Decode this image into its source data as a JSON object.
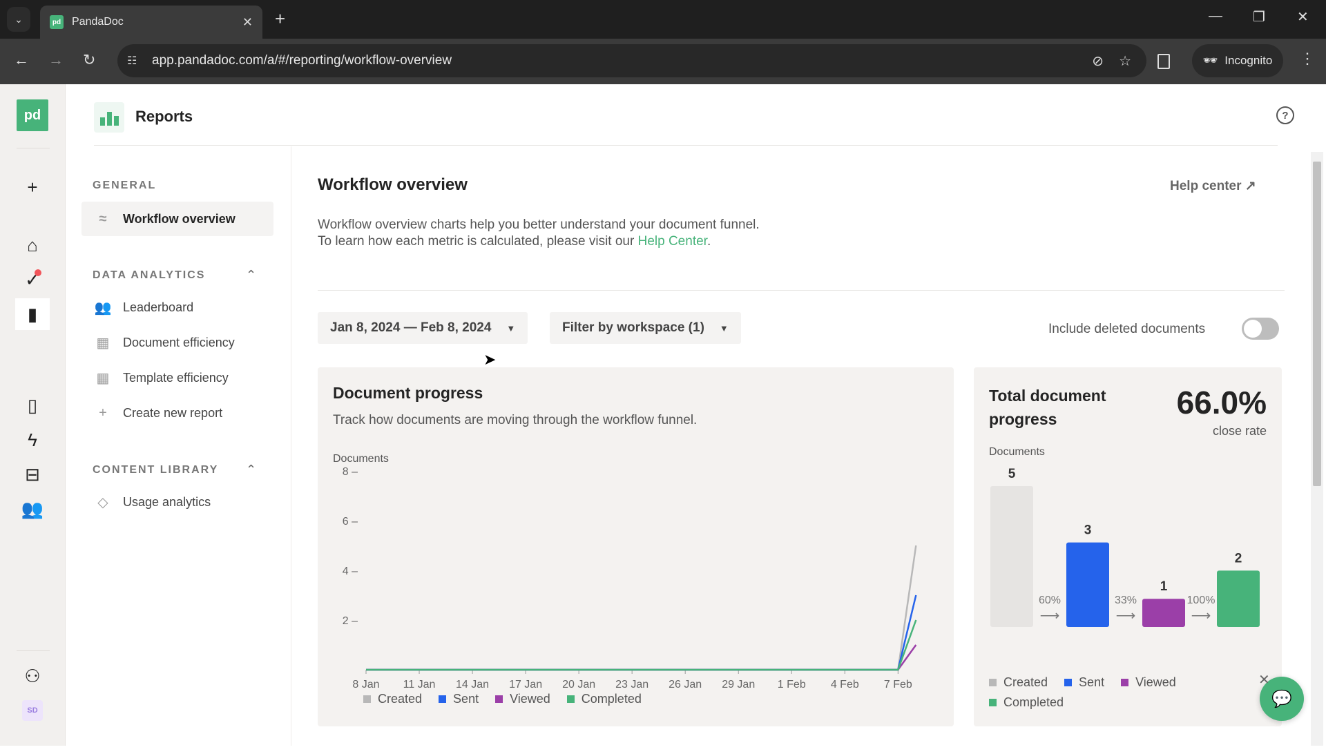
{
  "browser": {
    "tab_title": "PandaDoc",
    "tab_favicon": "pd",
    "url": "app.pandadoc.com/a/#/reporting/workflow-overview",
    "profile_label": "Incognito"
  },
  "rail": {
    "logo": "pd",
    "avatar_initials": "SD"
  },
  "header": {
    "title": "Reports"
  },
  "subnav": {
    "general_label": "GENERAL",
    "workflow_overview": "Workflow overview",
    "data_analytics_label": "DATA ANALYTICS",
    "data_items": [
      "Leaderboard",
      "Document efficiency",
      "Template efficiency",
      "Create new report"
    ],
    "content_library_label": "CONTENT LIBRARY",
    "content_items": [
      "Usage analytics"
    ]
  },
  "main": {
    "title": "Workflow overview",
    "help_center": "Help center",
    "description": "Workflow overview charts help you better understand your document funnel. To learn how each metric is calculated, please visit our ",
    "description_link": "Help Center",
    "description_end": ".",
    "date_range": "Jan 8, 2024 — Feb 8, 2024",
    "workspace_filter": "Filter by workspace (1)",
    "include_deleted_label": "Include deleted documents",
    "include_deleted_on": false
  },
  "colors": {
    "brand": "#47b37a",
    "created": "#b8b8b8",
    "sent": "#2563eb",
    "viewed": "#9b3fa8",
    "completed": "#47b37a"
  },
  "chart_data": [
    {
      "type": "line",
      "title": "Document progress",
      "subtitle": "Track how documents are moving through the workflow funnel.",
      "ylabel": "Documents",
      "xlabel": "",
      "ylim": [
        0,
        8
      ],
      "yticks": [
        2,
        4,
        6,
        8
      ],
      "x_ticks": [
        "8 Jan",
        "11 Jan",
        "14 Jan",
        "17 Jan",
        "20 Jan",
        "23 Jan",
        "26 Jan",
        "29 Jan",
        "1 Feb",
        "4 Feb",
        "7 Feb"
      ],
      "x_days": 31,
      "series": [
        {
          "name": "Created",
          "last_value": 5
        },
        {
          "name": "Sent",
          "last_value": 3
        },
        {
          "name": "Viewed",
          "last_value": 1
        },
        {
          "name": "Completed",
          "last_value": 2
        }
      ],
      "note": "All series are 0 from 8 Jan through 7 Feb, then rise on 8 Feb to their last_value",
      "legend": [
        "Created",
        "Sent",
        "Viewed",
        "Completed"
      ],
      "legend_position": "bottom-left"
    },
    {
      "type": "bar",
      "title": "Total document progress",
      "headline_value": "66.0%",
      "headline_label": "close rate",
      "ylabel": "Documents",
      "categories": [
        "Created",
        "Sent",
        "Viewed",
        "Completed"
      ],
      "values": [
        5,
        3,
        1,
        2
      ],
      "conversion_labels": [
        "60%",
        "33%",
        "100%"
      ],
      "legend": [
        "Created",
        "Sent",
        "Viewed",
        "Completed"
      ],
      "legend_position": "bottom-left"
    }
  ]
}
